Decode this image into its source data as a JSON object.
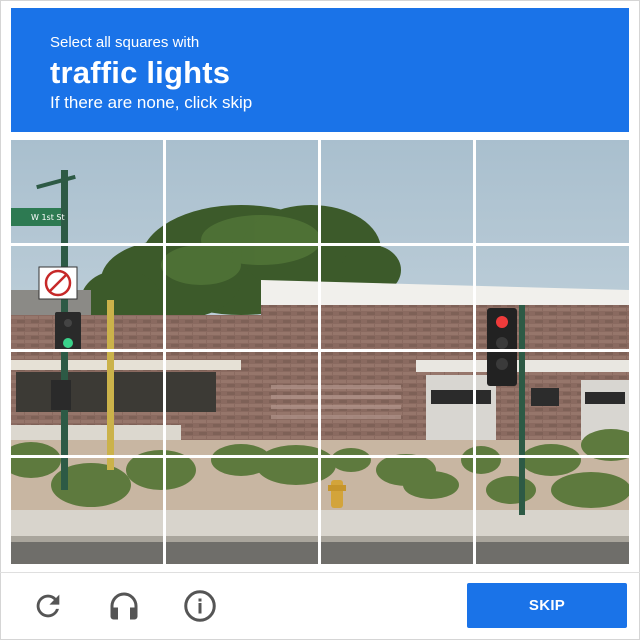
{
  "header": {
    "instruction_line1": "Select all squares with",
    "target_object": "traffic lights",
    "instruction_line3": "If there are none, click skip",
    "background_color": "#1a73e8"
  },
  "grid": {
    "rows": 4,
    "columns": 4,
    "image_description": "street corner with brick building, trees, shrubs, traffic signals and street sign"
  },
  "scene": {
    "street_sign_text": "W 1st St",
    "no_left_turn_sign": "no-left-turn"
  },
  "footer": {
    "reload_icon": "reload-icon",
    "audio_icon": "headphones-icon",
    "info_icon": "info-icon",
    "skip_label": "SKIP",
    "accent_color": "#1a73e8"
  }
}
